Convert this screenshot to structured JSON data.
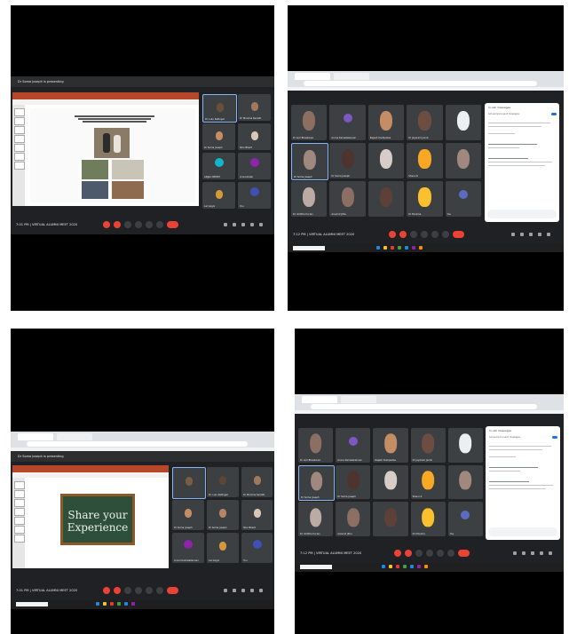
{
  "panels": [
    {
      "id": "p1",
      "presenter_text": "Dr Soma Joseph is presenting",
      "time_label": "7:01 PM",
      "meeting_name": "VIRTUAL ALUMNI MEET 2020",
      "slide_caption": "",
      "participants": [
        "Dr. Lulu Kallingal",
        "Dr Monima Kariath",
        "Dr Soma Joseph",
        "Shiv Bharti",
        "ANJALI REDDY",
        "Arunamalai",
        "Lal Gogoi",
        "You"
      ]
    },
    {
      "id": "p2",
      "time_label": "7:12 PM",
      "meeting_name": "VIRTUAL ALUMNI MEET 2020",
      "participants": [
        "Dr Anil Bhaskaran",
        "Aruna Kamalakannan",
        "Rajesh Pushpadas",
        "Dr Jayaram Jacob",
        "",
        "Dr Soma Joseph",
        "Dr Soma Joseph",
        "",
        "Shanu K",
        "",
        "Dr. Smitha Kurian",
        "Aravind Jithu",
        "",
        "Dr Monima",
        "You"
      ],
      "chat_title": "In-call messages",
      "chat_toggle": "Let everyone send messages"
    },
    {
      "id": "p3",
      "presenter_text": "Dr Soma Joseph is presenting",
      "time_label": "7:01 PM",
      "meeting_name": "VIRTUAL ALUMNI MEET 2020",
      "slide_caption": "Share your Experience",
      "participants": [
        "",
        "Dr. Lulu Kallingal",
        "Dr Monima Kariath",
        "Dr Soma Joseph",
        "Dr Soma Joseph",
        "Shiv Bharti",
        "Aruna Kamalakannan",
        "Lal Gogoi",
        "You"
      ]
    },
    {
      "id": "p4",
      "time_label": "7:12 PM",
      "meeting_name": "VIRTUAL ALUMNI MEET 2020",
      "participants": [
        "Dr Anil Bhaskaran",
        "Aruna Kamalakannan",
        "Rajesh Pushpadas",
        "Dr Jayaram Jacob",
        "",
        "Dr Soma Joseph",
        "Dr Soma Joseph",
        "",
        "Shanu K",
        "",
        "Dr. Smitha Kurian",
        "Aravind Jithu",
        "",
        "Dr Monima",
        "You"
      ],
      "chat_title": "In-call messages",
      "chat_toggle": "Let everyone send messages"
    }
  ],
  "colors": {
    "meet_dark": "#202124",
    "tile": "#3c4043",
    "end_call": "#ea4335",
    "accent": "#1a73e8"
  }
}
